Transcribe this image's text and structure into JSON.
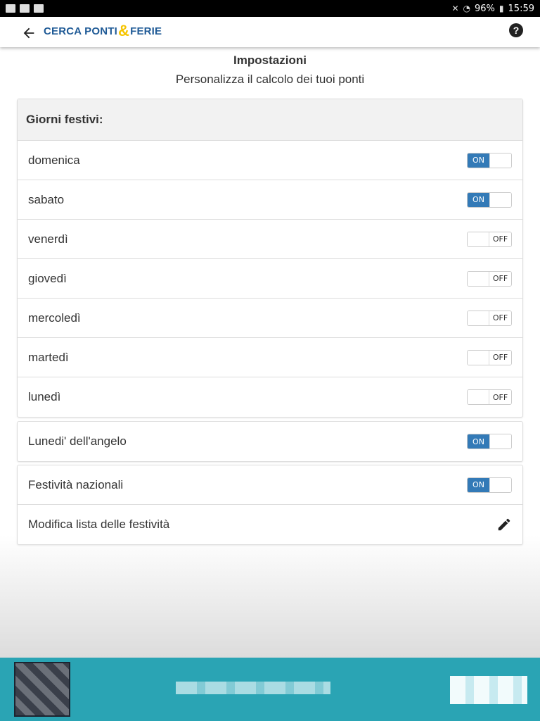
{
  "status_bar": {
    "battery": "96%",
    "time": "15:59"
  },
  "app_bar": {
    "logo_part1": "CERCA PONTI",
    "logo_amp": "&",
    "logo_part2": "FERIE",
    "help": "?"
  },
  "header": {
    "title": "Impostazioni",
    "subtitle": "Personalizza il calcolo dei tuoi ponti"
  },
  "holidays_card": {
    "title": "Giorni festivi:",
    "days": [
      {
        "label": "domenica",
        "state": "ON"
      },
      {
        "label": "sabato",
        "state": "ON"
      },
      {
        "label": "venerdì",
        "state": "OFF"
      },
      {
        "label": "giovedì",
        "state": "OFF"
      },
      {
        "label": "mercoledì",
        "state": "OFF"
      },
      {
        "label": "martedì",
        "state": "OFF"
      },
      {
        "label": "lunedì",
        "state": "OFF"
      }
    ]
  },
  "angel_card": {
    "label": "Lunedi' dell'angelo",
    "state": "ON"
  },
  "national_card": {
    "label": "Festività nazionali",
    "state": "ON",
    "edit_label": "Modifica lista delle festività"
  },
  "colors": {
    "toggle_on": "#337ab7",
    "logo_blue": "#1f5a96",
    "logo_amp": "#f5c400",
    "ad_bg": "#2aa4b4"
  }
}
